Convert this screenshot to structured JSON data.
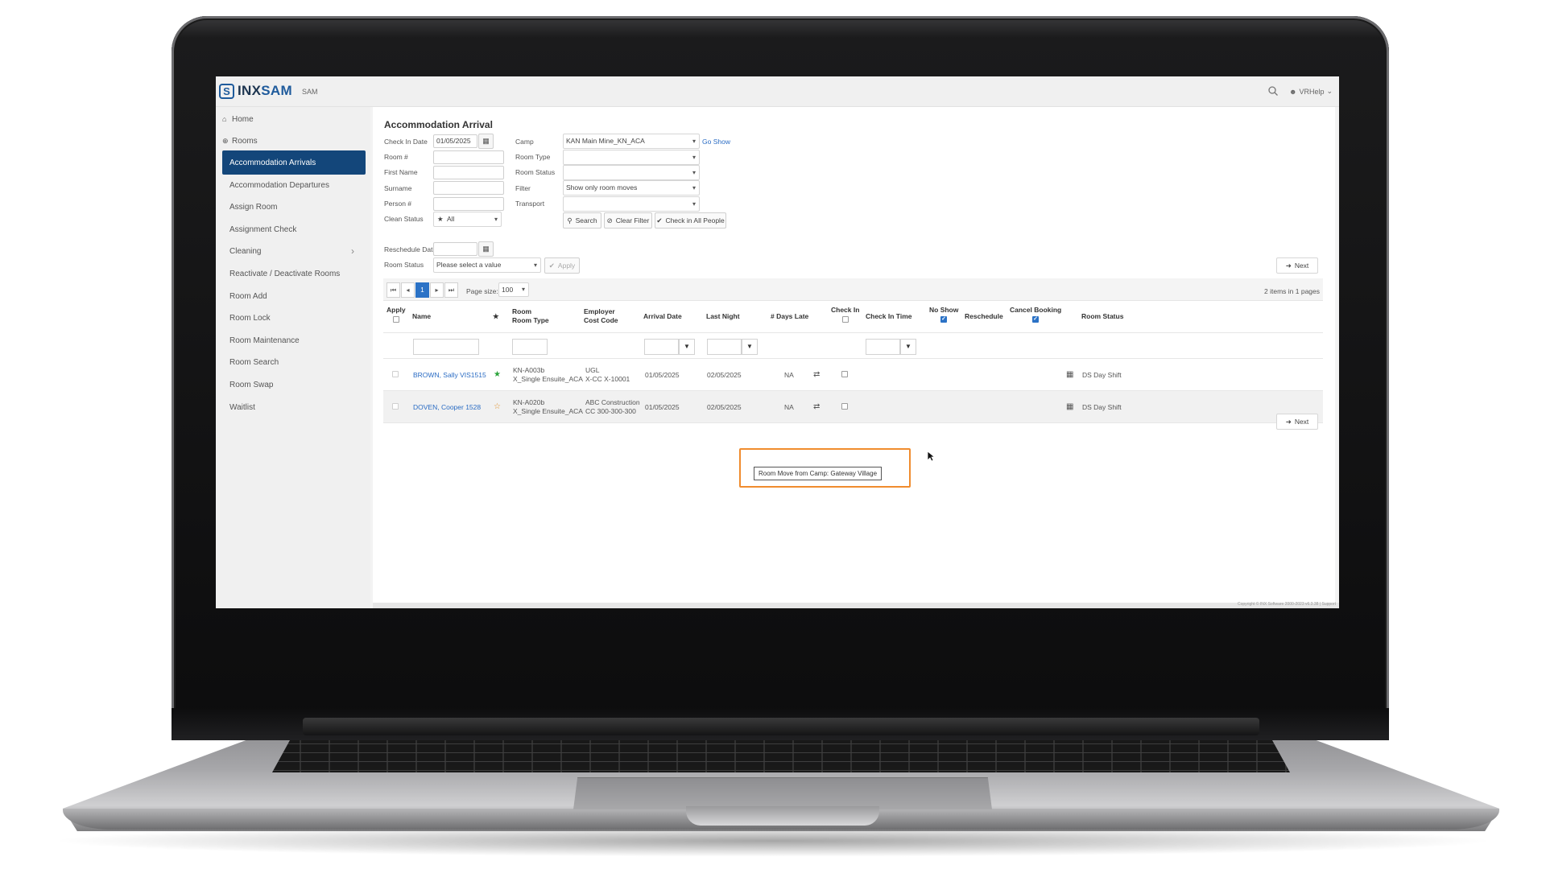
{
  "app": {
    "logo_mark": "S",
    "logo_prefix": "INX",
    "logo_suffix": "SAM",
    "app_name": "SAM",
    "user_label": "VRHelp",
    "copyright": "Copyright © INX Software 2000-2023 v6.3.38 | Support"
  },
  "sidebar": {
    "home": "Home",
    "rooms": "Rooms",
    "items": [
      {
        "label": "Accommodation Arrivals"
      },
      {
        "label": "Accommodation Departures"
      },
      {
        "label": "Assign Room"
      },
      {
        "label": "Assignment Check"
      },
      {
        "label": "Cleaning"
      },
      {
        "label": "Reactivate / Deactivate Rooms"
      },
      {
        "label": "Room Add"
      },
      {
        "label": "Room Lock"
      },
      {
        "label": "Room Maintenance"
      },
      {
        "label": "Room Search"
      },
      {
        "label": "Room Swap"
      },
      {
        "label": "Waitlist"
      }
    ]
  },
  "page": {
    "title": "Accommodation Arrival"
  },
  "form": {
    "check_in_date_label": "Check In Date",
    "check_in_date_value": "01/05/2025",
    "room_no_label": "Room #",
    "first_name_label": "First Name",
    "surname_label": "Surname",
    "person_no_label": "Person #",
    "clean_status_label": "Clean Status",
    "clean_status_value": "All",
    "camp_label": "Camp",
    "camp_value": "KAN Main Mine_KN_ACA",
    "go_show_label": "Go Show",
    "room_type_label": "Room Type",
    "room_status_label": "Room Status",
    "filter_label": "Filter",
    "filter_value": "Show only room moves",
    "transport_label": "Transport",
    "search_btn": "Search",
    "clear_filter_btn": "Clear Filter",
    "check_in_all_btn": "Check in All People",
    "reschedule_date_label": "Reschedule Date",
    "room_status2_label": "Room Status",
    "room_status2_placeholder": "Please select a value",
    "apply_btn": "Apply",
    "next_btn": "Next"
  },
  "grid": {
    "current_page": "1",
    "page_size_label": "Page size:",
    "page_size_value": "100",
    "items_info": "2 items in 1 pages",
    "headers": {
      "apply": "Apply",
      "name": "Name",
      "room": "Room",
      "room_type": "Room Type",
      "employer": "Employer",
      "cost_code": "Cost Code",
      "arrival_date": "Arrival Date",
      "last_night": "Last Night",
      "days_late": "# Days Late",
      "check_in": "Check In",
      "check_in_time": "Check In Time",
      "no_show": "No Show",
      "reschedule": "Reschedule",
      "cancel_booking": "Cancel Booking",
      "room_status": "Room Status"
    },
    "rows": [
      {
        "name": "BROWN, Sally VIS1515",
        "star": "green",
        "room": "KN-A003b",
        "room_type": "X_Single Ensuite_ACA",
        "employer": "UGL",
        "cost_code": "X-CC X-10001",
        "arrival_date": "01/05/2025",
        "last_night": "02/05/2025",
        "days_late": "NA",
        "room_status": "DS Day Shift"
      },
      {
        "name": "DOVEN, Cooper 1528",
        "star": "orange",
        "room": "KN-A020b",
        "room_type": "X_Single Ensuite_ACA",
        "employer": "ABC Construction",
        "cost_code": "CC 300-300-300",
        "arrival_date": "01/05/2025",
        "last_night": "02/05/2025",
        "days_late": "NA",
        "room_status": "DS Day Shift"
      }
    ],
    "tooltip": "Room Move from Camp: Gateway Village"
  },
  "colors": {
    "primary": "#13467a",
    "link": "#2a6cc4",
    "highlight": "#f08c2e"
  }
}
